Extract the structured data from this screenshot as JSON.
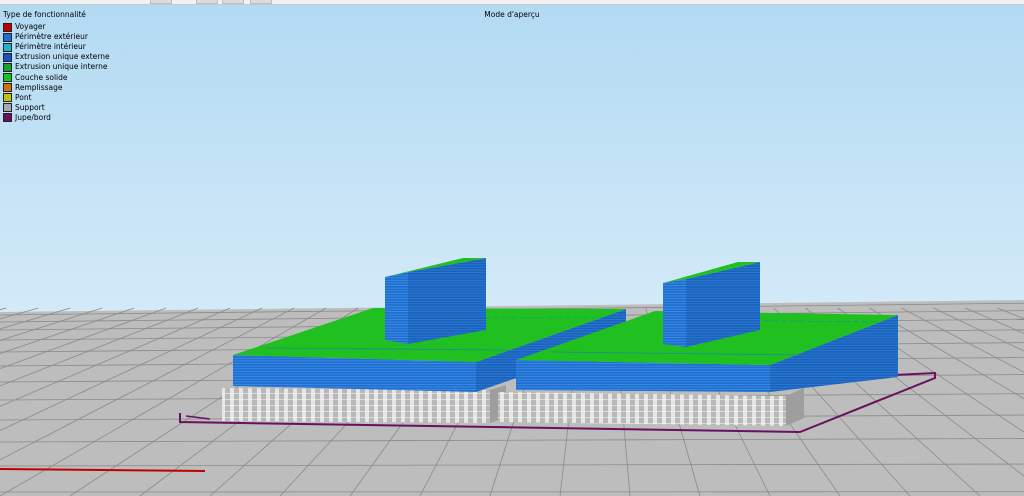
{
  "view_mode_title": "Mode d'aperçu",
  "legend": {
    "title": "Type de fonctionnalité",
    "items": [
      {
        "label": "Voyager",
        "color": "#c00000"
      },
      {
        "label": "Périmètre extérieur",
        "color": "#1f6fd0"
      },
      {
        "label": "Périmètre intérieur",
        "color": "#20b0c8"
      },
      {
        "label": "Extrusion unique externe",
        "color": "#2050c0"
      },
      {
        "label": "Extrusion unique interne",
        "color": "#18a030"
      },
      {
        "label": "Couche solide",
        "color": "#20c020"
      },
      {
        "label": "Remplissage",
        "color": "#d07010"
      },
      {
        "label": "Pont",
        "color": "#c0c010"
      },
      {
        "label": "Support",
        "color": "#a8a8a8"
      },
      {
        "label": "Jupe/bord",
        "color": "#6a1060"
      }
    ]
  },
  "colors": {
    "sky_top": "#b0d8f2",
    "sky_bottom": "#d8ecf8",
    "bed": "#bdbdbd",
    "bed_grid": "#8c8c8c",
    "perimeter": "#1f6fd0",
    "top_surface": "#20c020",
    "support": "#a8a8a8",
    "skirt": "#6a1060",
    "travel": "#c00000"
  }
}
